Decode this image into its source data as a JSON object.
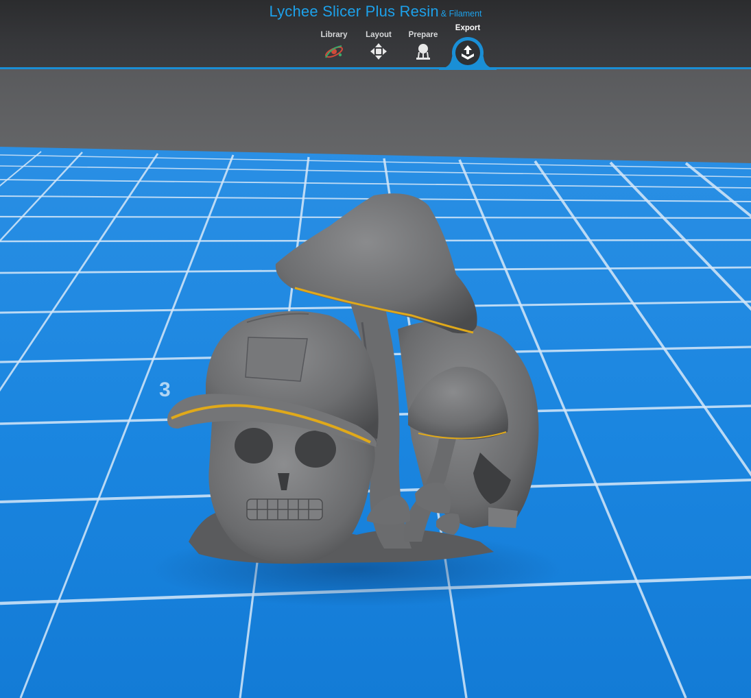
{
  "app": {
    "title_main": "Lychee Slicer Plus Resin",
    "title_sub": "& Filament"
  },
  "tabs": [
    {
      "label": "Library",
      "icon": "library-icon"
    },
    {
      "label": "Layout",
      "icon": "move-arrows-icon"
    },
    {
      "label": "Prepare",
      "icon": "supports-icon"
    },
    {
      "label": "Export",
      "icon": "export-upload-icon",
      "active": true
    }
  ],
  "viewport": {
    "model_name": "skull-mushroom-model",
    "grid_label": "3",
    "colors": {
      "plate_blue": "#1b86e0",
      "grid_line": "#d6e8f8",
      "model_gray": "#6f7072",
      "wall_gray": "#5c5d61",
      "accent_blue": "#1a8fd6",
      "support_yellow": "#e0a91a"
    }
  }
}
